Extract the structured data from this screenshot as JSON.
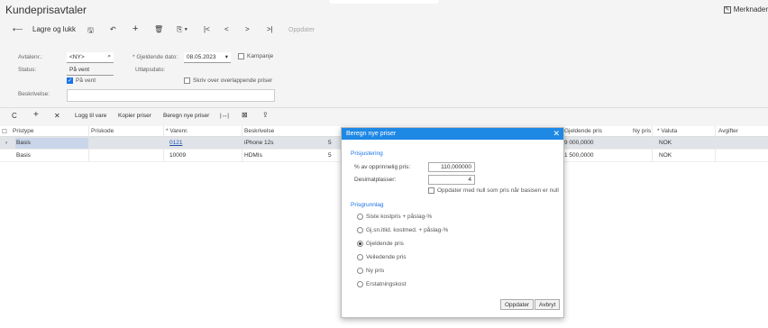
{
  "title": "Kundeprisavtaler",
  "merknader": "Merknader",
  "toolbar": {
    "back_glyph": "⟵",
    "save_close_label": "Lagre og lukk",
    "save_glyph": "🖫",
    "undo_glyph": "↶",
    "add_glyph": "+",
    "delete_glyph": "🗑",
    "copy_glyph": "⎘ ▾",
    "first_glyph": "|<",
    "prev_glyph": "<",
    "next_glyph": ">",
    "last_glyph": ">|",
    "update_label": "Oppdater"
  },
  "form": {
    "avtalenr_label": "Avtalenr.:",
    "avtalenr_value": "<NY>",
    "gjeldende_label": "* Gjeldende dato:",
    "gjeldende_value": "08.05.2023",
    "kampanje_label": "Kampanje",
    "status_label": "Status:",
    "status_value": "På vent",
    "utlopsdato_label": "Utløpsdato:",
    "paa_vent_label": "På vent",
    "skriv_over_label": "Skriv over overlappende priser",
    "beskrivelse_label": "Beskrivelse:",
    "beskrivelse_value": ""
  },
  "gridbar": {
    "refresh_glyph": "C",
    "add_glyph": "+",
    "delete_glyph": "✕",
    "logg_label": "Logg til vare",
    "kopier_label": "Kopier priser",
    "beregn_label": "Beregn nye priser",
    "fit_glyph": "|↔|",
    "export_glyph": "⊠",
    "upload_glyph": "⇪"
  },
  "grid": {
    "headers": [
      "Pristype",
      "Priskode",
      "* Varenr.",
      "Beskrivelse",
      "Gjeldende pris",
      "Ny pris",
      "* Valuta",
      "Avgifter"
    ],
    "rows": [
      {
        "pristype": "Basis",
        "priskode": "",
        "varenr": "0121",
        "beskrivelse": "iPhone 12s",
        "extra": "5",
        "gjeldende": "9 000,0000",
        "nypris": "",
        "valuta": "NOK"
      },
      {
        "pristype": "Basis",
        "priskode": "",
        "varenr": "10009",
        "beskrivelse": "HDMIs",
        "extra": "5",
        "gjeldende": "1 500,0000",
        "nypris": "",
        "valuta": "NOK"
      }
    ]
  },
  "dialog": {
    "title": "Beregn nye priser",
    "close_glyph": "✕",
    "section_prisjustering": "Prisjustering",
    "pct_label": "% av opprinnelig pris:",
    "pct_value": "110,000000",
    "desimal_label": "Desimalplasser:",
    "desimal_value": "4",
    "oppdater_null_label": "Oppdater med null som pris når basisen er null",
    "section_prisgrunnlag": "Prisgrunnlag",
    "options": [
      "Siste kostpris + påslag-%",
      "Gj.sn.itlid. kostmed. + påslag-%",
      "Gjeldende pris",
      "Veiledende pris",
      "Ny pris",
      "Erstatningskost"
    ],
    "selected_index": 2,
    "update_button": "Oppdater",
    "cancel_button": "Avbryt"
  }
}
